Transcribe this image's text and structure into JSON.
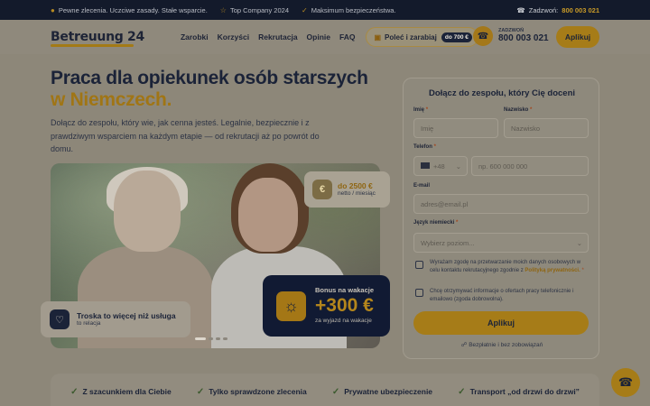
{
  "topbar": {
    "items": [
      {
        "icon": "location-pin-icon",
        "text": "Pewne zlecenia. Uczciwe zasady. Stałe wsparcie."
      },
      {
        "icon": "star-icon",
        "text": "Top Company 2024"
      },
      {
        "icon": "check-icon",
        "text": "Maksimum bezpieczeństwa."
      }
    ],
    "contact_label": "Zadzwoń:",
    "contact_number": "800 003 021"
  },
  "header": {
    "logo": "Betreuung 24",
    "nav": [
      "Zarobki",
      "Korzyści",
      "Rekrutacja",
      "Opinie",
      "FAQ"
    ],
    "refer_label": "Poleć i zarabiaj",
    "refer_badge": "do 700 €",
    "call_label": "ZADZWOŃ",
    "call_number": "800 003 021",
    "apply_label": "Aplikuj"
  },
  "hero": {
    "title_line1": "Praca dla opiekunek osób starszych",
    "title_accent": "w Niemczech.",
    "lead": "Dołącz do zespołu, który wie, jak cenna jesteś. Legalnie, bezpiecznie i z prawdziwym wsparciem na każdym etapie — od rekrutacji aż po powrót do domu.",
    "salary_amount": "do 2500 €",
    "salary_sub": "netto / miesiąc",
    "bonus_label": "Bonus na wakacje",
    "bonus_value": "+300 €",
    "bonus_sub": "za wyjazd na wakacje",
    "care_title": "Troska to więcej niż usługa",
    "care_sub": "to relacja",
    "carousel_dots": 4,
    "carousel_active": 0
  },
  "form": {
    "title": "Dołącz do zespołu, który Cię doceni",
    "first_name_label": "Imię",
    "first_name_placeholder": "Imię",
    "last_name_label": "Nazwisko",
    "last_name_placeholder": "Nazwisko",
    "phone_label": "Telefon",
    "phone_prefix": "+48",
    "phone_placeholder": "np. 600 000 000",
    "email_label": "E-mail",
    "email_placeholder": "adres@email.pl",
    "language_label": "Język niemiecki",
    "language_placeholder": "Wybierz poziom...",
    "consent1_text": "Wyrażam zgodę na przetwarzanie moich danych osobowych w celu kontaktu rekrutacyjnego zgodnie z",
    "consent1_link": "Polityką prywatności.",
    "consent2_text": "Chcę otrzymywać informacje o ofertach pracy telefonicznie i emailowo (zgoda dobrowolna).",
    "submit_label": "Aplikuj",
    "free_note": "Bezpłatnie i bez zobowiązań"
  },
  "features": [
    "Z szacunkiem dla Ciebie",
    "Tylko sprawdzone zlecenia",
    "Prywatne ubezpieczenie",
    "Transport „od drzwi do drzwi”"
  ],
  "colors": {
    "accent": "#a67c18",
    "navy": "#131a2b",
    "overlay_bg": "#8d8779"
  }
}
